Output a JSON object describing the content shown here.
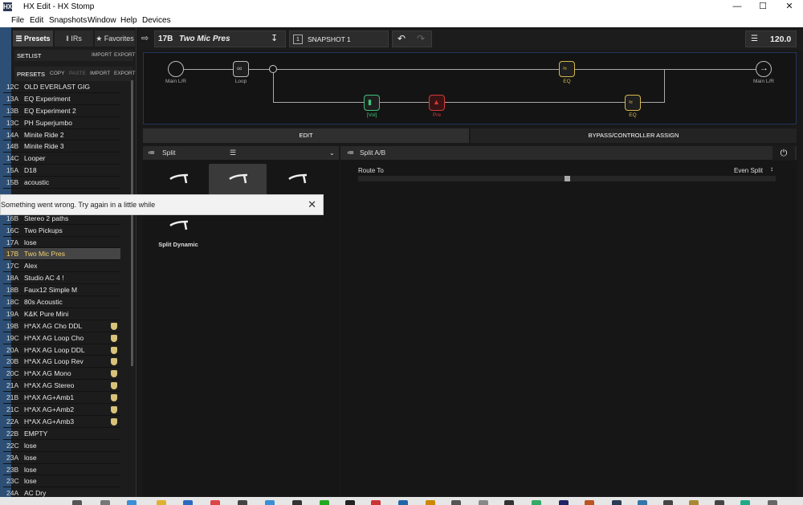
{
  "window": {
    "title": "HX Edit - HX Stomp",
    "app_icon": "HX",
    "controls": [
      "minimize-icon",
      "maximize-icon",
      "close-icon"
    ]
  },
  "menu": [
    "File",
    "Edit",
    "Snapshots",
    "Window",
    "Help",
    "Devices"
  ],
  "sidebar": {
    "tabs": [
      {
        "label": "Presets",
        "icon": "list-icon"
      },
      {
        "label": "IRs",
        "icon": "waveform-icon"
      },
      {
        "label": "Favorites",
        "icon": "star-icon"
      }
    ],
    "setlist": {
      "label": "SETLIST",
      "actions": [
        "IMPORT",
        "EXPORT"
      ]
    },
    "presets_header": {
      "label": "PRESETS",
      "actions": [
        "COPY",
        "PASTE",
        "IMPORT",
        "EXPORT"
      ]
    },
    "presets": [
      {
        "id": "12C",
        "name": "OLD EVERLAST GIG"
      },
      {
        "id": "13A",
        "name": "EQ Experiment"
      },
      {
        "id": "13B",
        "name": "EQ Experiment 2"
      },
      {
        "id": "13C",
        "name": "PH Superjumbo"
      },
      {
        "id": "14A",
        "name": "Minite Ride 2"
      },
      {
        "id": "14B",
        "name": "Minite Ride 3"
      },
      {
        "id": "14C",
        "name": "Looper"
      },
      {
        "id": "15A",
        "name": "D18"
      },
      {
        "id": "15B",
        "name": "acoustic"
      },
      {
        "id": "",
        "name": ""
      },
      {
        "id": "",
        "name": ""
      },
      {
        "id": "16B",
        "name": "Stereo 2 paths"
      },
      {
        "id": "16C",
        "name": "Two Pickups"
      },
      {
        "id": "17A",
        "name": "lose"
      },
      {
        "id": "17B",
        "name": "Two Mic Pres",
        "selected": true
      },
      {
        "id": "17C",
        "name": "Alex"
      },
      {
        "id": "18A",
        "name": "Studio AC 4 !"
      },
      {
        "id": "18B",
        "name": "Faux12 Simple  M"
      },
      {
        "id": "18C",
        "name": "80s Acoustic"
      },
      {
        "id": "19A",
        "name": "K&K Pure Mini"
      },
      {
        "id": "19B",
        "name": "H*AX AG Cho DDL",
        "shield": true
      },
      {
        "id": "19C",
        "name": "H*AX AG Loop Cho",
        "shield": true
      },
      {
        "id": "20A",
        "name": "H*AX AG Loop DDL",
        "shield": true
      },
      {
        "id": "20B",
        "name": "H*AX AG Loop Rev",
        "shield": true
      },
      {
        "id": "20C",
        "name": "H*AX AG Mono",
        "shield": true
      },
      {
        "id": "21A",
        "name": "H*AX AG Stereo",
        "shield": true
      },
      {
        "id": "21B",
        "name": "H*AX AG+Amb1",
        "shield": true
      },
      {
        "id": "21C",
        "name": "H*AX AG+Amb2",
        "shield": true
      },
      {
        "id": "22A",
        "name": "H*AX AG+Amb3",
        "shield": true
      },
      {
        "id": "22B",
        "name": "EMPTY"
      },
      {
        "id": "22C",
        "name": "lose"
      },
      {
        "id": "23A",
        "name": "lose"
      },
      {
        "id": "23B",
        "name": "lose"
      },
      {
        "id": "23C",
        "name": "lose"
      },
      {
        "id": "24A",
        "name": "AC Dry"
      }
    ]
  },
  "topbar": {
    "preset_id": "17B",
    "preset_name": "Two Mic Pres",
    "snapshot_number": "1",
    "snapshot_label": "SNAPSHOT 1",
    "tempo": "120.0"
  },
  "signal_flow": {
    "input_label": "Main L/R",
    "output_label": "Main L/R",
    "loop_label": "Loop",
    "eq_top_label": "EQ",
    "vol_label": "[Vol]",
    "pre_label": "Pre",
    "eq_bottom_label": "EQ",
    "colors": {
      "eq": "#d4b84a",
      "vol": "#3fc07a",
      "pre": "#d23a3a",
      "border": "#22355a"
    }
  },
  "tabs": {
    "edit": "EDIT",
    "bypass": "BYPASS/CONTROLLER ASSIGN"
  },
  "left_panel": {
    "title": "Split",
    "split_options": [
      {
        "label": ""
      },
      {
        "label": "",
        "selected": true
      },
      {
        "label": ""
      },
      {
        "label": "Split Dynamic"
      }
    ]
  },
  "right_panel": {
    "title": "Split A/B",
    "param_label": "Route To",
    "param_value": "Even Split",
    "slider_fraction": 0.5
  },
  "toast": {
    "message": "Something went wrong. Try again in a little while"
  }
}
